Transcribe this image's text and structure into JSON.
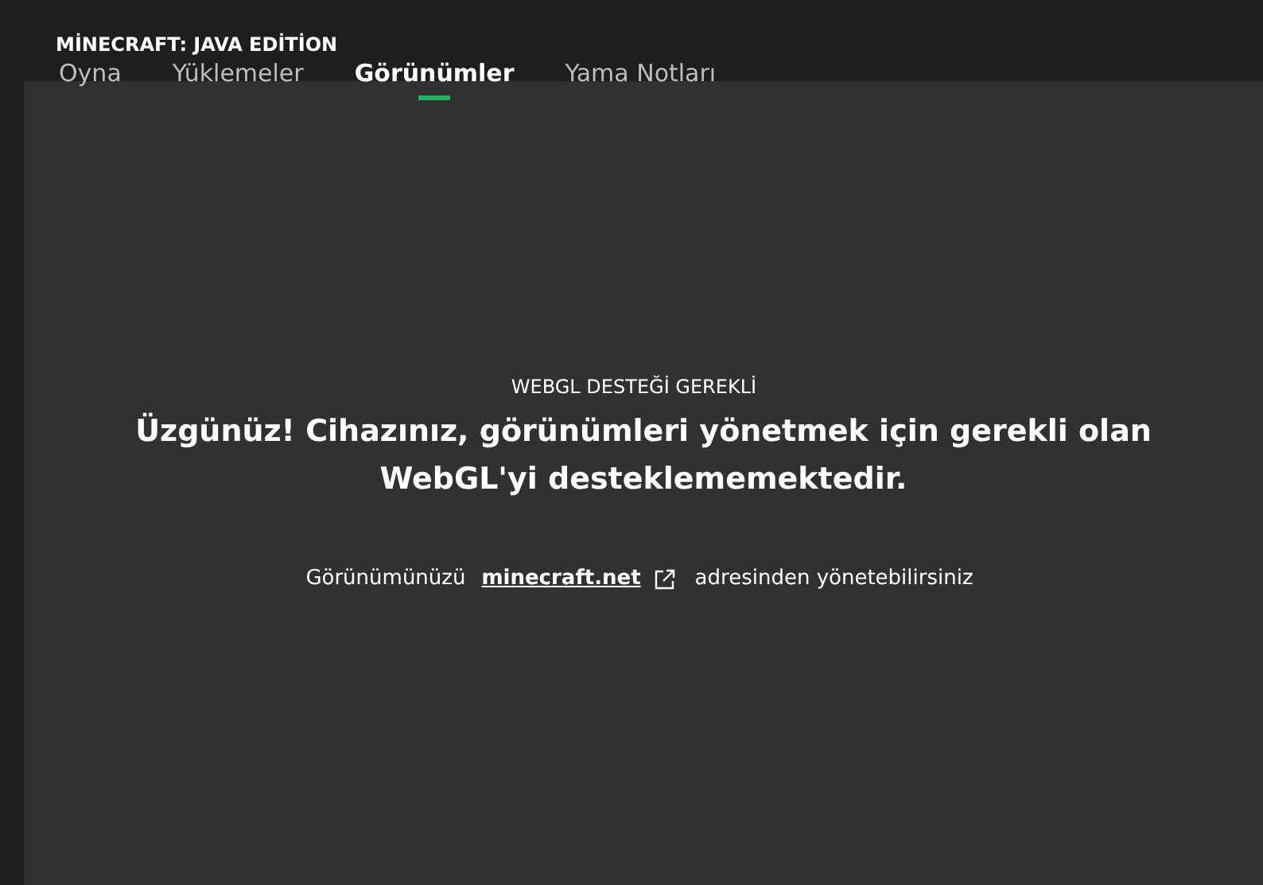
{
  "header": {
    "title": "MİNECRAFT: JAVA EDİTİON"
  },
  "tabs": [
    {
      "label": "Oyna",
      "selected": false
    },
    {
      "label": "Yüklemeler",
      "selected": false
    },
    {
      "label": "Görünümler",
      "selected": true
    },
    {
      "label": "Yama Notları",
      "selected": false
    }
  ],
  "message": {
    "eyebrow": "WEBGL DESTEĞİ GEREKLİ",
    "headline": "Üzgünüz! Cihazınız, görünümleri yönetmek için gerekli olan WebGL'yi desteklememektedir.",
    "note_before": "Görünümünüzü",
    "link": "minecraft.net",
    "note_after": "adresinden yönetebilirsiniz"
  }
}
